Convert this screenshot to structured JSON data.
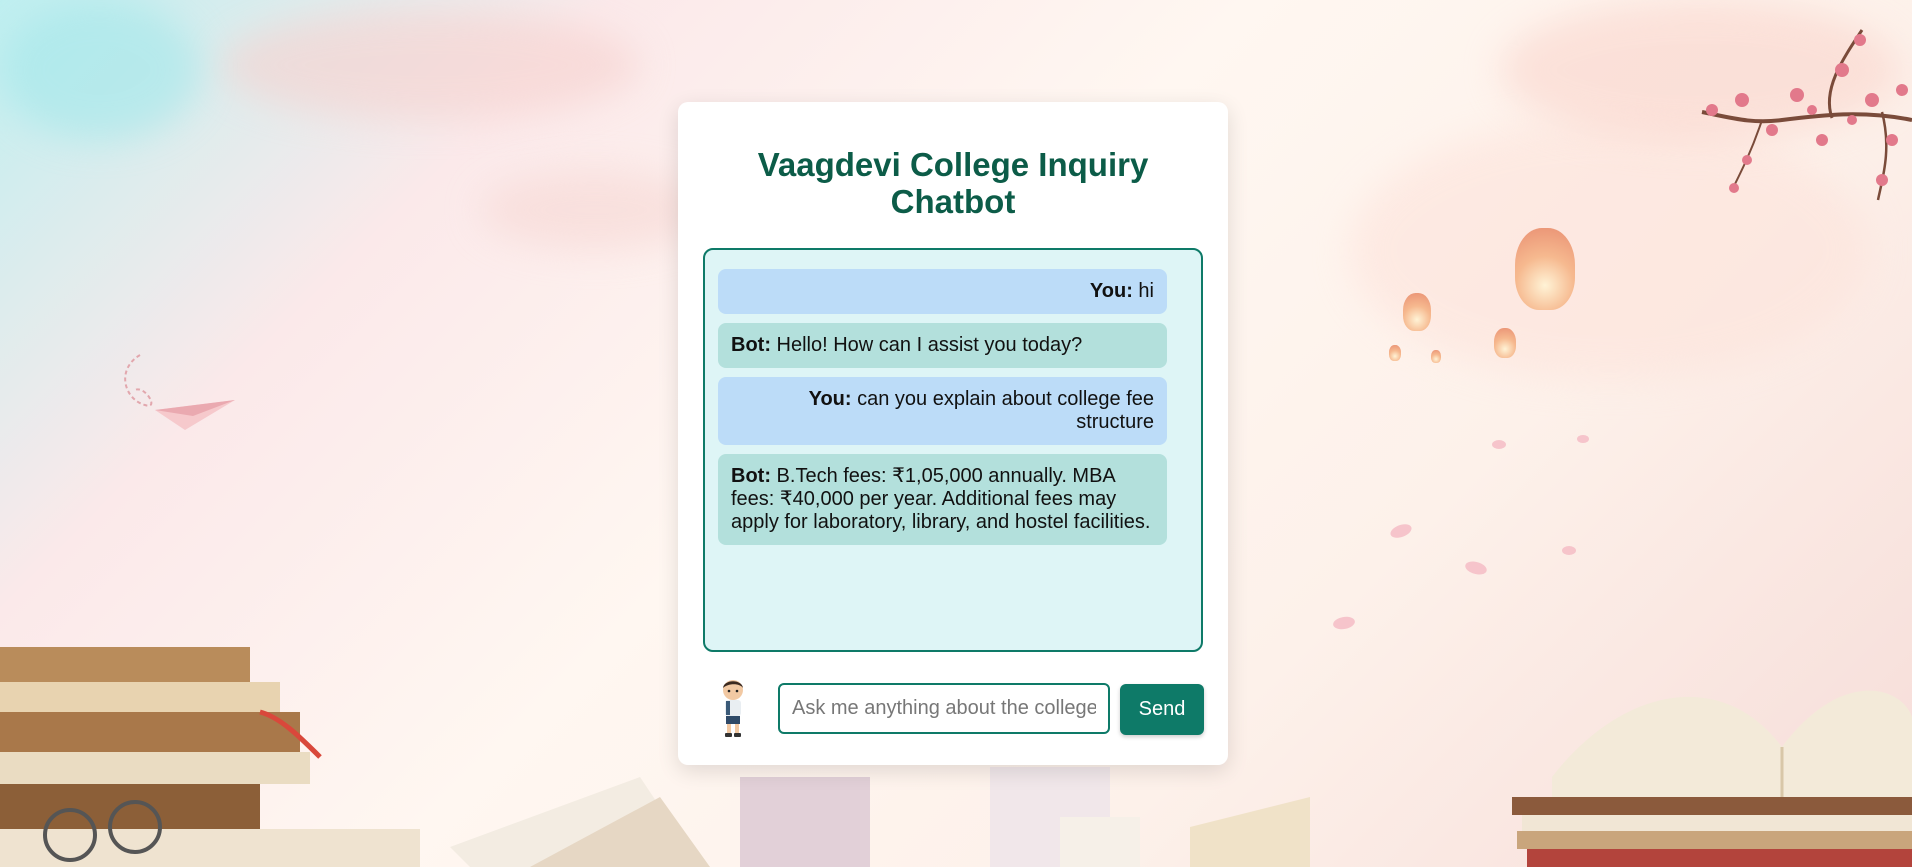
{
  "header": {
    "title_line1": "Vaagdevi College Inquiry",
    "title_line2": "Chatbot"
  },
  "messages": [
    {
      "sender": "You:",
      "text": "hi",
      "role": "user"
    },
    {
      "sender": "Bot:",
      "text": "Hello! How can I assist you today?",
      "role": "bot"
    },
    {
      "sender": "You:",
      "text": "can you explain about college fee structure",
      "role": "user"
    },
    {
      "sender": "Bot:",
      "text": "B.Tech fees: ₹1,05,000 annually. MBA fees: ₹40,000 per year. Additional fees may apply for laboratory, library, and hostel facilities.",
      "role": "bot"
    }
  ],
  "composer": {
    "placeholder": "Ask me anything about the college...",
    "value": "",
    "send_label": "Send"
  },
  "icons": {
    "avatar": "student-avatar-icon"
  },
  "colors": {
    "accent": "#0e7a68",
    "title": "#0c5c48",
    "user_bubble": "#bcdcf8",
    "bot_bubble": "#b3e0dc",
    "chat_bg": "#def5f6"
  }
}
